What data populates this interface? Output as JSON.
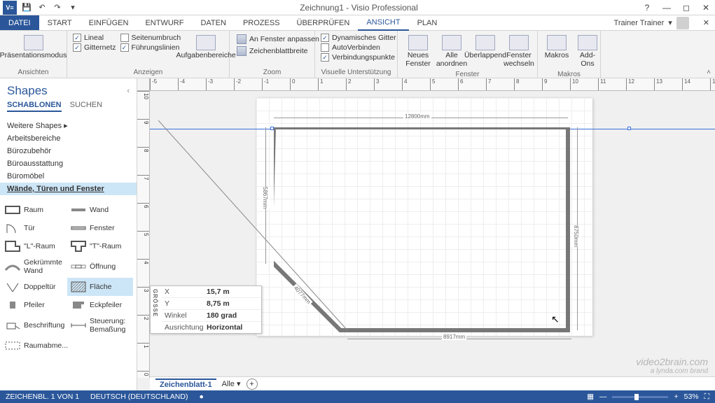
{
  "title": "Zeichnung1 - Visio Professional",
  "user": "Trainer Trainer",
  "tabs": {
    "file": "DATEI",
    "list": [
      "START",
      "EINFÜGEN",
      "ENTWURF",
      "DATEN",
      "PROZESS",
      "ÜBERPRÜFEN",
      "ANSICHT",
      "PLAN"
    ],
    "active": 6
  },
  "ribbon": {
    "ansichten": {
      "label": "Ansichten",
      "btn": "Präsentationsmodus"
    },
    "anzeigen": {
      "label": "Anzeigen",
      "checks": [
        "Lineal",
        "Seitenumbruch",
        "Gitternetz",
        "Führungslinien"
      ],
      "more": "Aufgabenbereiche"
    },
    "zoom": {
      "label": "Zoom",
      "items": [
        "An Fenster anpassen",
        "Zeichenblattbreite"
      ]
    },
    "visuelle": {
      "label": "Visuelle Unterstützung",
      "checks": [
        "Dynamisches Gitter",
        "AutoVerbinden",
        "Verbindungspunkte"
      ]
    },
    "fenster": {
      "label": "Fenster",
      "btns": [
        "Neues\nFenster",
        "Alle\nanordnen",
        "Überlappend",
        "Fenster\nwechseln"
      ]
    },
    "makros": {
      "label": "Makros",
      "btns": [
        "Makros",
        "Add-\nOns"
      ]
    }
  },
  "shapes": {
    "title": "Shapes",
    "subtabs": [
      "SCHABLONEN",
      "SUCHEN"
    ],
    "more": "Weitere Shapes",
    "cats": [
      "Arbeitsbereiche",
      "Bürozubehör",
      "Büroausstattung",
      "Büromöbel",
      "Wände, Türen und Fenster"
    ],
    "activeCat": 4,
    "items": [
      {
        "name": "Raum"
      },
      {
        "name": "Wand"
      },
      {
        "name": "Tür"
      },
      {
        "name": "Fenster"
      },
      {
        "name": "\"L\"-Raum"
      },
      {
        "name": "\"T\"-Raum"
      },
      {
        "name": "Gekrümmte Wand"
      },
      {
        "name": "Öffnung"
      },
      {
        "name": "Doppeltür"
      },
      {
        "name": "Fläche"
      },
      {
        "name": "Pfeiler"
      },
      {
        "name": "Eckpfeiler"
      },
      {
        "name": "Beschriftung"
      },
      {
        "name": "Steuerung: Bemaßung"
      },
      {
        "name": "Raumabme..."
      }
    ],
    "selected": 9
  },
  "size_popup": {
    "side": "GRÖSSE",
    "rows": [
      {
        "k": "X",
        "v": "15,7 m"
      },
      {
        "k": "Y",
        "v": "8,75 m"
      },
      {
        "k": "Winkel",
        "v": "180 grad"
      },
      {
        "k": "Ausrichtung",
        "v": "Horizontal"
      }
    ]
  },
  "dims": {
    "top": "12800mm",
    "right": "8750mm",
    "bottom": "8917mm",
    "diag": "4077mm",
    "left": "5867mm"
  },
  "pagetabs": {
    "active": "Zeichenblatt-1",
    "filter": "Alle"
  },
  "status": {
    "page": "ZEICHENBL. 1 VON 1",
    "lang": "DEUTSCH (DEUTSCHLAND)",
    "zoom": "53%"
  },
  "watermark": {
    "main": "video2brain.com",
    "sub": "a lynda.com brand"
  }
}
